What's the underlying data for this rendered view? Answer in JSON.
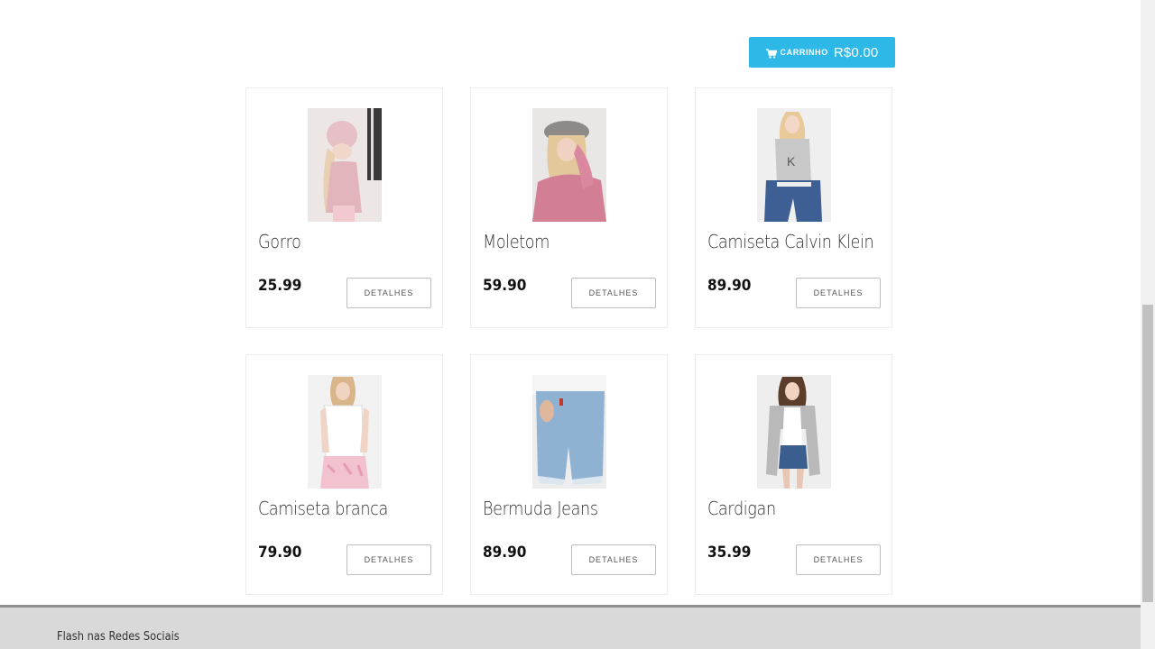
{
  "header": {
    "cart_label": "CARRINHO",
    "cart_amount": "R$0.00",
    "cart_icon": "cart-icon"
  },
  "products": [
    {
      "name": "Gorro",
      "price": "25.99",
      "details_label": "DETALHES"
    },
    {
      "name": "Moletom",
      "price": "59.90",
      "details_label": "DETALHES"
    },
    {
      "name": "Camiseta Calvin Klein",
      "price": "89.90",
      "details_label": "DETALHES"
    },
    {
      "name": "Camiseta branca",
      "price": "79.90",
      "details_label": "DETALHES"
    },
    {
      "name": "Bermuda Jeans",
      "price": "89.90",
      "details_label": "DETALHES"
    },
    {
      "name": "Cardigan",
      "price": "35.99",
      "details_label": "DETALHES"
    }
  ],
  "footer": {
    "text": "Flash nas Redes Sociais"
  },
  "colors": {
    "accent": "#2db8e8",
    "footer_bg": "#d9d9d9"
  }
}
